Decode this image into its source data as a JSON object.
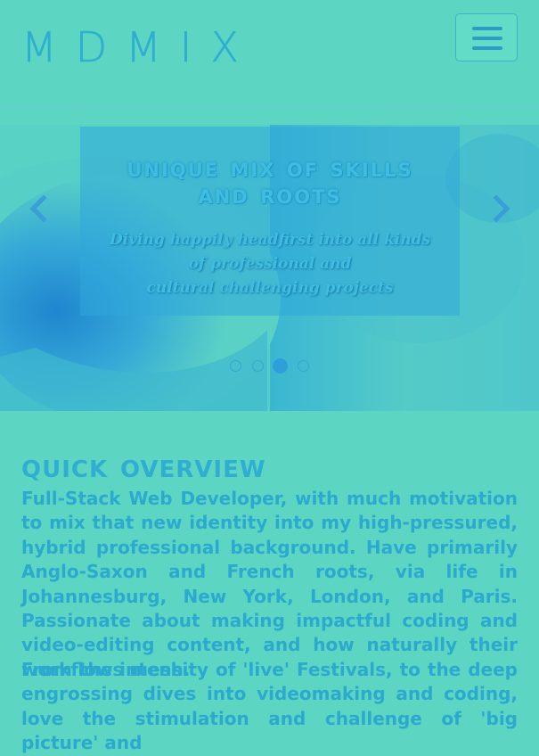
{
  "brand": {
    "name": "MDMIX"
  },
  "nav": {
    "toggle_label": "Toggle navigation"
  },
  "carousel": {
    "title_line1": "Unique mix of skills",
    "title_line2": "and roots",
    "caption_line1": "Diving happily headfirst into all kinds",
    "caption_line2": "of professional and",
    "caption_line3": "cultural challenging projects",
    "prev_icon": "chevron-left-icon",
    "next_icon": "chevron-right-icon",
    "slide_count": 4,
    "active_slide": 3
  },
  "overview": {
    "title": "Quick overview",
    "paragraph1": "Full-Stack Web Developer, with much motivation to mix that new identity into my high-pressured, hybrid professional background. Have primarily Anglo-Saxon and French roots, via life in Johannesburg, New York, London, and Paris. Passionate about making impactful coding and video-editing content, and how naturally their workflows mesh.",
    "paragraph2": "From the intensity of 'live' Festivals, to the deep engrossing dives into videomaking and coding, love the stimulation and challenge of 'big picture' and"
  },
  "colors": {
    "background": "#5cd6c2",
    "accent": "#2faed2",
    "caption_overlay": "#2fa8da"
  }
}
